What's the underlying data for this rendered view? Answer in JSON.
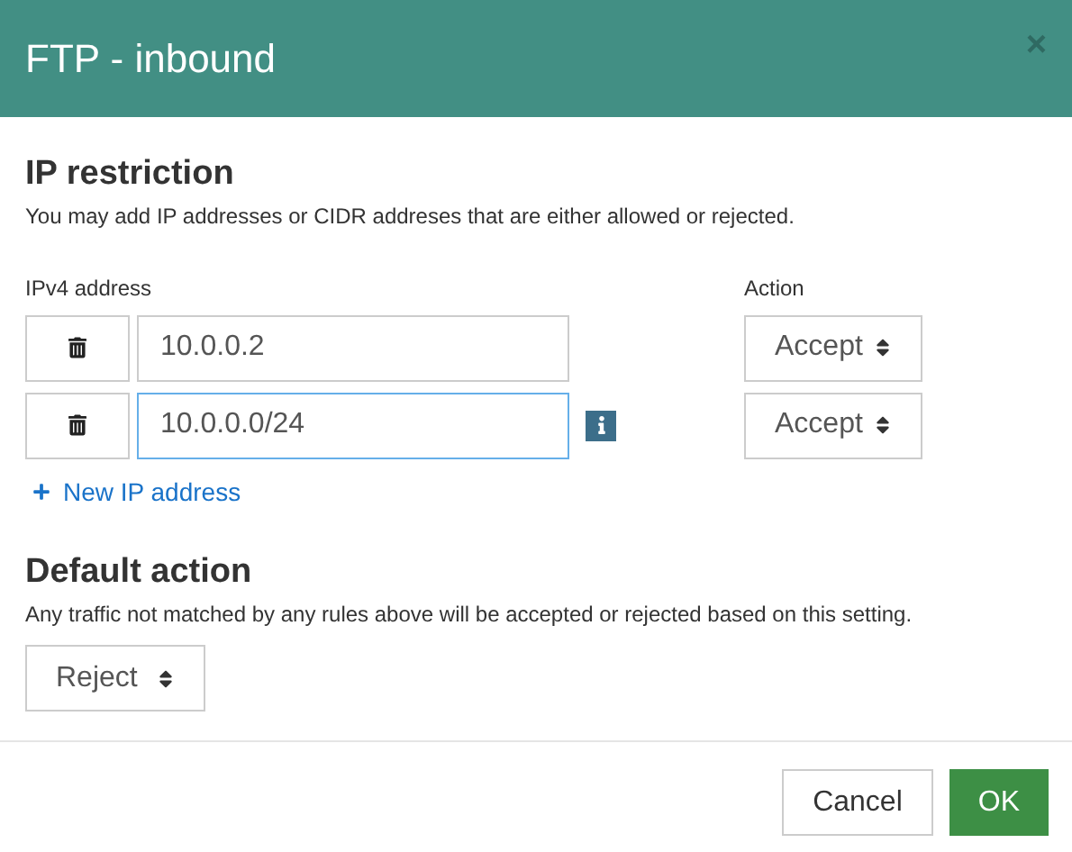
{
  "dialog": {
    "title": "FTP - inbound",
    "close": "×"
  },
  "ip_restriction": {
    "heading": "IP restriction",
    "description": "You may add IP addresses or CIDR addreses that are either allowed or rejected.",
    "address_label": "IPv4 address",
    "action_label": "Action",
    "rules": [
      {
        "address": "10.0.0.2",
        "focused": false,
        "info": false,
        "action": "Accept"
      },
      {
        "address": "10.0.0.0/24",
        "focused": true,
        "info": true,
        "action": "Accept"
      }
    ],
    "add_link": "New IP address"
  },
  "default_action": {
    "heading": "Default action",
    "description": "Any traffic not matched by any rules above will be accepted or rejected based on this setting.",
    "value": "Reject"
  },
  "buttons": [
    {
      "label": "Cancel",
      "kind": "secondary"
    },
    {
      "label": "OK",
      "kind": "primary"
    }
  ]
}
